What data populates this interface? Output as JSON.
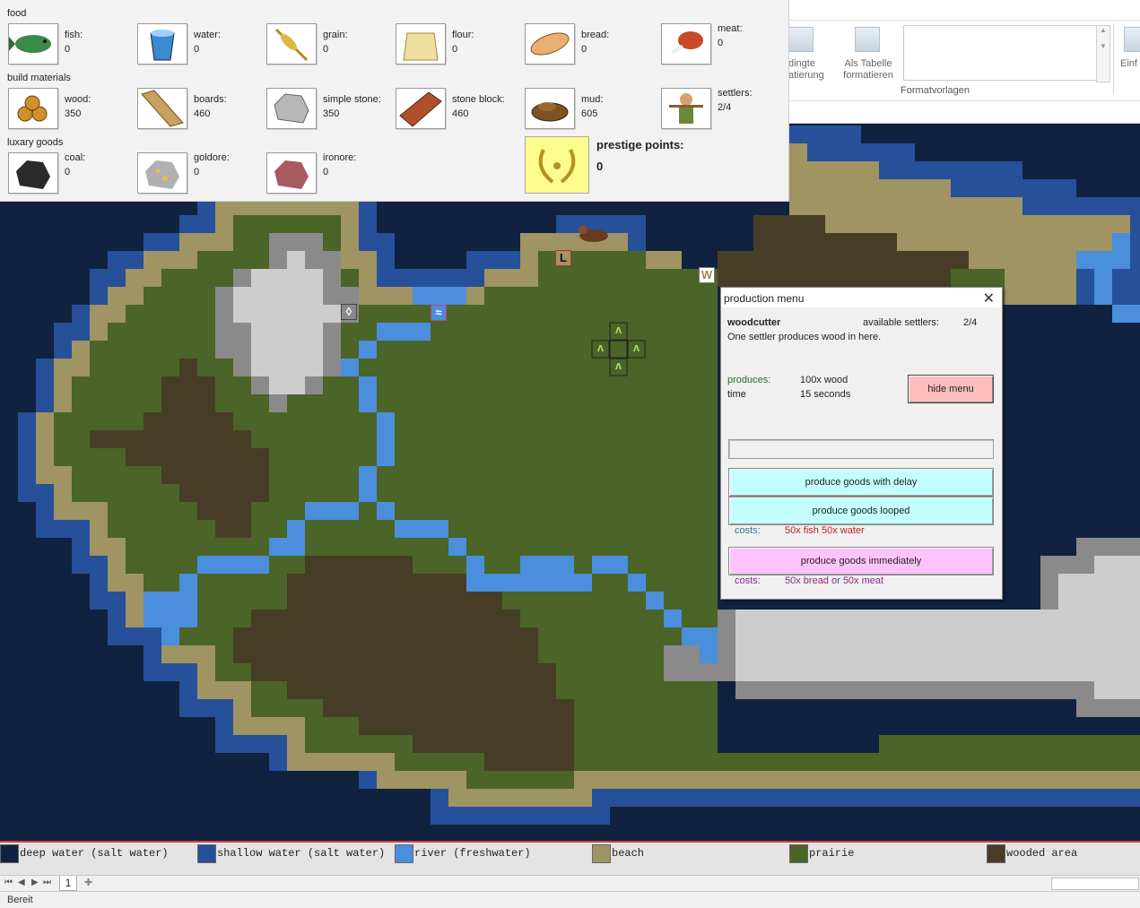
{
  "resources": {
    "sections": {
      "food": "food",
      "build": "build materials",
      "luxury": "luxary goods"
    },
    "items": [
      {
        "name": "fish:",
        "value": "0",
        "icon": "fish-icon"
      },
      {
        "name": "water:",
        "value": "0",
        "icon": "water-bucket-icon"
      },
      {
        "name": "grain:",
        "value": "0",
        "icon": "grain-icon"
      },
      {
        "name": "flour:",
        "value": "0",
        "icon": "flour-sack-icon"
      },
      {
        "name": "bread:",
        "value": "0",
        "icon": "bread-icon"
      },
      {
        "name": "meat:",
        "value": "0",
        "icon": "meat-icon"
      },
      {
        "name": "wood:",
        "value": "350",
        "icon": "wood-logs-icon"
      },
      {
        "name": "boards:",
        "value": "460",
        "icon": "boards-icon"
      },
      {
        "name": "simple stone:",
        "value": "350",
        "icon": "stone-icon"
      },
      {
        "name": "stone block:",
        "value": "460",
        "icon": "brick-wall-icon"
      },
      {
        "name": "mud:",
        "value": "605",
        "icon": "mud-icon"
      },
      {
        "name": "settlers:",
        "value": "2/4",
        "icon": "settler-icon"
      },
      {
        "name": "coal:",
        "value": "0",
        "icon": "coal-icon"
      },
      {
        "name": "goldore:",
        "value": "0",
        "icon": "goldore-icon"
      },
      {
        "name": "ironore:",
        "value": "0",
        "icon": "ironore-icon"
      }
    ],
    "prestige": {
      "label": "prestige points:",
      "value": "0",
      "icon": "laurel-wreath-icon"
    }
  },
  "ribbon": {
    "btn1_line1": "dingte",
    "btn1_line2": "atierung",
    "btn2_line1": "Als Tabelle",
    "btn2_line2": "formatieren",
    "group_label": "Formatvorlagen",
    "right_label": "Einf"
  },
  "map": {
    "markers": {
      "woodcutter": "W",
      "lumber": "L",
      "river": "≈",
      "stone": "◊",
      "grass": "ʌ"
    },
    "colors": {
      "deep_water": "#10223f",
      "shallow_water": "#27509a",
      "river": "#4a8edc",
      "beach": "#9f9462",
      "prairie": "#4b6427",
      "wooded_area": "#473d27",
      "stone_dark": "#8a8a8a",
      "stone_light": "#cdcdcd"
    }
  },
  "production_menu": {
    "title": "production menu",
    "building": "woodcutter",
    "settlers_label": "available settlers:",
    "settlers_value": "2/4",
    "description": "One settler produces wood in here.",
    "produces_label": "produces:",
    "produces_value": "100x wood",
    "time_label": "time",
    "time_value": "15 seconds",
    "hide_button": "hide menu",
    "btn_delay": "produce goods with delay",
    "btn_looped": "produce goods looped",
    "costs_label": "costs:",
    "costs_1": "50x fish 50x water",
    "btn_immediately": "produce goods immediately",
    "costs_2": "50x bread or 50x meat"
  },
  "legend": [
    {
      "label": "deep water (salt water)",
      "color": "#10223f"
    },
    {
      "label": "shallow water (salt water)",
      "color": "#27509a"
    },
    {
      "label": "river (freshwater)",
      "color": "#4a8edc"
    },
    {
      "label": "beach",
      "color": "#9f9462"
    },
    {
      "label": "prairie",
      "color": "#4b6427"
    },
    {
      "label": "wooded area",
      "color": "#473d27"
    }
  ],
  "sheets": {
    "tab": "1"
  },
  "status": {
    "text": "Bereit"
  }
}
